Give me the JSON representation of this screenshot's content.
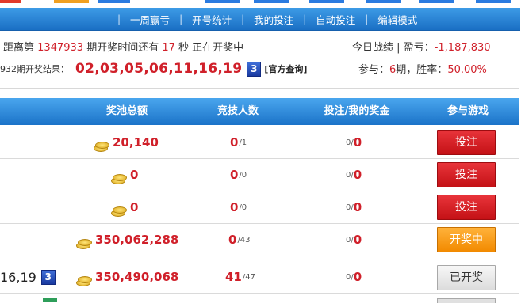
{
  "nav": {
    "items": [
      "一周赢亏",
      "开号统计",
      "我的投注",
      "自动投注",
      "编辑模式"
    ],
    "separator": "|",
    "top_colors": [
      "#e23a2a",
      "#f0a020",
      "#2a7be0",
      "#2a7be0",
      "#2a7be0",
      "#2a7be0",
      "#2a7be0",
      "#2a7be0"
    ]
  },
  "info": {
    "prefix": "距离第",
    "issue": "1347933",
    "mid": "期开奖时间还有",
    "seconds": "17",
    "suffix": "秒 正在开奖中",
    "prev_issue": "932",
    "prev_label": "期开奖结果：",
    "result": "02,03,05,06,11,16,19",
    "result_badge": "3",
    "official": "[官方查询]",
    "today_label": "今日战绩",
    "sep": "|",
    "profit_label": "盈亏：",
    "profit": "-1,187,830",
    "participate_prefix": "参与：",
    "periods": "6",
    "periods_unit": "期，胜率：",
    "win_rate": "50.00%"
  },
  "table": {
    "headers": [
      "奖池总额",
      "竞技人数",
      "投注/我的奖金",
      "参与游戏"
    ],
    "rows": [
      {
        "pool": "20,140",
        "part_a": "0",
        "part_b": "/1",
        "bet_a": "0/",
        "bet_b": "0",
        "action": "投注",
        "style": "red"
      },
      {
        "pool": "0",
        "part_a": "0",
        "part_b": "/0",
        "bet_a": "0/",
        "bet_b": "0",
        "action": "投注",
        "style": "red"
      },
      {
        "pool": "0",
        "part_a": "0",
        "part_b": "/0",
        "bet_a": "0/",
        "bet_b": "0",
        "action": "投注",
        "style": "red"
      },
      {
        "pool": "350,062,288",
        "part_a": "0",
        "part_b": "/43",
        "bet_a": "0/",
        "bet_b": "0",
        "action": "开奖中",
        "style": "orange"
      },
      {
        "pool": "350,490,068",
        "part_a": "41",
        "part_b": "/47",
        "bet_a": "0/",
        "bet_b": "0",
        "action": "已开奖",
        "style": "gray"
      }
    ],
    "last_result": "16,19",
    "last_badge": "3"
  },
  "colors": {
    "accent_red": "#d0202a",
    "nav_blue": "#1a6fc4"
  }
}
